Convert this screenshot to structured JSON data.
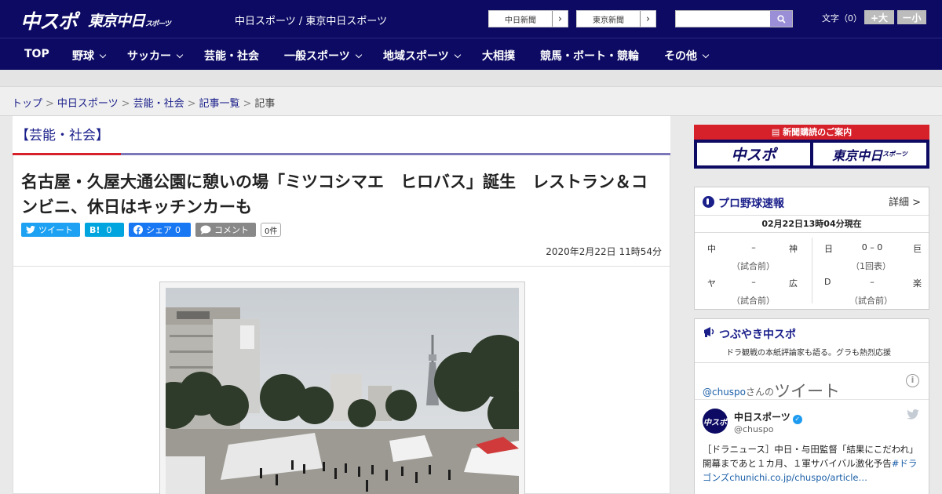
{
  "header": {
    "logo_chuspo": "中スポ",
    "logo_tokyo": "東京中日",
    "logo_tokyo_small": "スポーツ",
    "tagline": "中日スポーツ / 東京中日スポーツ",
    "link_chunichi": "中日新聞",
    "link_tokyo": "東京新聞",
    "search_placeholder": "",
    "font_label": "文字（0）",
    "font_larger": "+大",
    "font_smaller": "ー小"
  },
  "nav": [
    {
      "label": "TOP",
      "dropdown": false
    },
    {
      "label": "野球",
      "dropdown": true
    },
    {
      "label": "サッカー",
      "dropdown": true
    },
    {
      "label": "芸能・社会",
      "dropdown": false
    },
    {
      "label": "一般スポーツ",
      "dropdown": true
    },
    {
      "label": "地域スポーツ",
      "dropdown": true
    },
    {
      "label": "大相撲",
      "dropdown": false
    },
    {
      "label": "競馬・ボート・競輪",
      "dropdown": false
    },
    {
      "label": "その他",
      "dropdown": true
    }
  ],
  "breadcrumb": {
    "items": [
      "トップ",
      "中日スポーツ",
      "芸能・社会",
      "記事一覧"
    ],
    "current": "記事"
  },
  "article": {
    "category": "【芸能・社会】",
    "headline": "名古屋・久屋大通公園に憩いの場「ミツコシマエ　ヒロバス」誕生　レストラン＆コンビニ、休日はキッチンカーも",
    "share": {
      "tweet": "ツイート",
      "hatena": "B!",
      "hatena_count": "0",
      "facebook": "シェア",
      "facebook_count": "0",
      "comment": "コメント",
      "comment_count": "0件"
    },
    "date": "2020年2月22日 11時54分"
  },
  "sidebar": {
    "ad": {
      "title": "新聞購読のご案内",
      "logo1": "中スポ",
      "logo2": "東京中日",
      "logo2_small": "スポーツ"
    },
    "baseball": {
      "title": "プロ野球速報",
      "more": "詳細 >",
      "asof": "02月22日13時04分現在",
      "games": [
        {
          "home": "中",
          "score": "–",
          "away": "神",
          "status": "（試合前）"
        },
        {
          "home": "日",
          "score": "0 – 0",
          "away": "巨",
          "status": "（1回表）"
        },
        {
          "home": "ヤ",
          "score": "–",
          "away": "広",
          "status": "（試合前）"
        },
        {
          "home": "D",
          "score": "–",
          "away": "楽",
          "status": "（試合前）"
        }
      ]
    },
    "twitter": {
      "title": "つぶやき中スポ",
      "subtitle": "ドラ観戦の本紙評論家も語る。グラも熱烈応援",
      "timeline_handle": "@chuspo",
      "timeline_san": "さんの",
      "timeline_word": "ツイート",
      "tweet_name": "中日スポーツ",
      "tweet_handle": "@chuspo",
      "avatar_text": "中スポ",
      "tweet_text": "［ドラニュース］中日・与田監督「結果にこだわれ」 開幕まであと１カ月、１軍サバイバル激化予告",
      "tweet_tag": "#ドラゴンズ",
      "tweet_link": "chunichi.co.jp/chuspo/article…"
    }
  },
  "colors": {
    "navy": "#0c0a63",
    "red": "#d6202a",
    "link": "#1a1f8a",
    "twitter": "#1da1f2",
    "hatena": "#00a4de",
    "facebook": "#1877f2",
    "comment": "#888888"
  }
}
